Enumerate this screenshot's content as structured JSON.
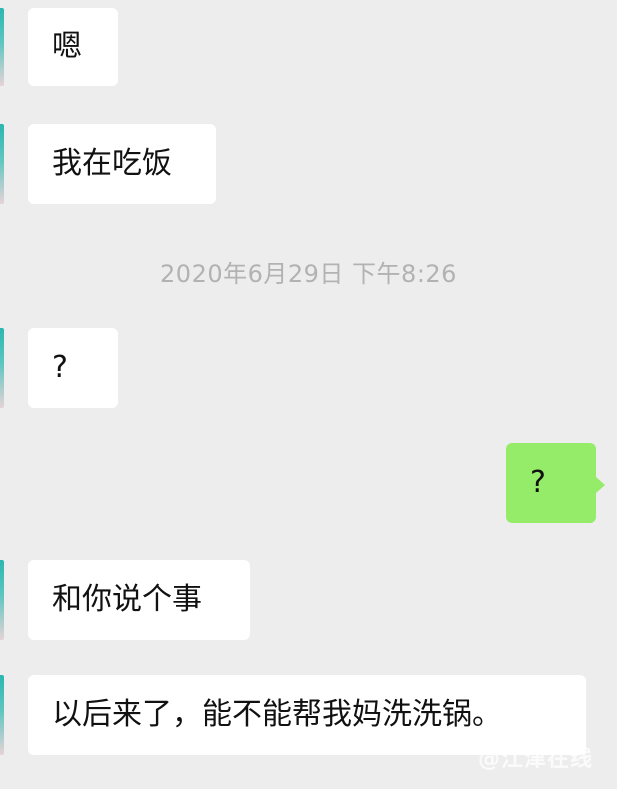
{
  "messages": [
    {
      "side": "incoming",
      "text": "嗯"
    },
    {
      "side": "incoming",
      "text": "我在吃饭"
    },
    {
      "side": "incoming",
      "text": "?"
    },
    {
      "side": "outgoing",
      "text": "?"
    },
    {
      "side": "incoming",
      "text": "和你说个事"
    },
    {
      "side": "incoming",
      "text": "以后来了，能不能帮我妈洗洗锅。"
    }
  ],
  "timestamp": "2020年6月29日 下午8:26",
  "watermark": "@江津在线",
  "colors": {
    "background": "#ededed",
    "incoming_bubble": "#ffffff",
    "outgoing_bubble": "#95ec69",
    "timestamp_text": "#b2b2b2"
  }
}
